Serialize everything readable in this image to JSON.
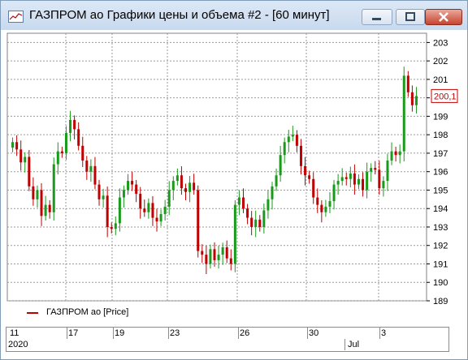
{
  "window": {
    "title": "ГАЗПРОМ ао Графики цены и объема #2 - [60 минут]"
  },
  "legend": {
    "label": "ГАЗПРОМ ао [Price]",
    "color": "#c00000"
  },
  "price_axis": {
    "ticks": [
      "203",
      "202",
      "201",
      "200",
      "199",
      "198",
      "197",
      "196",
      "195",
      "194",
      "193",
      "192",
      "191",
      "190",
      "189"
    ],
    "current_price": "200,1"
  },
  "time_axis": {
    "days": [
      "11",
      "17",
      "19",
      "23",
      "26",
      "30",
      "3"
    ],
    "months": [
      "2020",
      "Jul"
    ]
  },
  "colors": {
    "up": "#1a9a1a",
    "down": "#c00000",
    "grid": "#808080"
  },
  "chart_data": {
    "type": "candlestick",
    "ylim": [
      189,
      203.5
    ],
    "yticks": [
      203,
      202,
      201,
      200,
      199,
      198,
      197,
      196,
      195,
      194,
      193,
      192,
      191,
      190,
      189
    ],
    "x_day_labels": [
      "11",
      "17",
      "19",
      "23",
      "26",
      "30",
      "3"
    ],
    "last_price": 200.1,
    "close_series": [
      197.6,
      197.2,
      196.5,
      196.8,
      195.2,
      194.5,
      195.0,
      193.6,
      194.2,
      193.8,
      196.4,
      197.1,
      197.0,
      198.1,
      198.8,
      198.3,
      197.4,
      196.6,
      196.0,
      196.3,
      195.3,
      194.5,
      194.7,
      193.0,
      192.9,
      193.2,
      194.6,
      195.0,
      195.5,
      195.3,
      194.8,
      194.0,
      193.8,
      194.3,
      193.5,
      193.3,
      193.7,
      194.1,
      195.0,
      195.5,
      195.8,
      195.1,
      194.9,
      195.4,
      195.0,
      191.7,
      191.5,
      191.0,
      191.8,
      191.2,
      191.5,
      191.9,
      191.3,
      191.0,
      194.2,
      194.6,
      194.0,
      193.5,
      193.0,
      193.4,
      193.0,
      193.9,
      194.5,
      195.2,
      195.8,
      196.9,
      197.6,
      197.9,
      198.0,
      197.4,
      196.3,
      195.8,
      195.6,
      194.6,
      194.2,
      193.8,
      194.1,
      194.4,
      195.3,
      195.5,
      195.7,
      195.6,
      195.9,
      195.3,
      195.6,
      195.0,
      196.0,
      196.2,
      196.1,
      195.1,
      195.5,
      196.6,
      197.1,
      196.9,
      197.1,
      201.2,
      200.3,
      199.6,
      200.1
    ]
  }
}
